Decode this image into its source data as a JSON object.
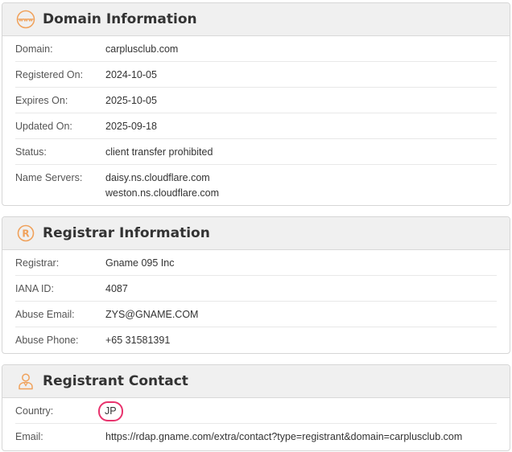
{
  "domain_info": {
    "title": "Domain Information",
    "rows": [
      {
        "label": "Domain:",
        "value": "carplusclub.com"
      },
      {
        "label": "Registered On:",
        "value": "2024-10-05"
      },
      {
        "label": "Expires On:",
        "value": "2025-10-05"
      },
      {
        "label": "Updated On:",
        "value": "2025-09-18"
      },
      {
        "label": "Status:",
        "value": "client transfer prohibited"
      }
    ],
    "name_servers_label": "Name Servers:",
    "name_servers": [
      "daisy.ns.cloudflare.com",
      "weston.ns.cloudflare.com"
    ]
  },
  "registrar_info": {
    "title": "Registrar Information",
    "rows": [
      {
        "label": "Registrar:",
        "value": "Gname 095 Inc"
      },
      {
        "label": "IANA ID:",
        "value": "4087"
      },
      {
        "label": "Abuse Email:",
        "value": "ZYS@GNAME.COM"
      },
      {
        "label": "Abuse Phone:",
        "value": "+65 31581391"
      }
    ]
  },
  "registrant_contact": {
    "title": "Registrant Contact",
    "rows": [
      {
        "label": "Country:",
        "value": "JP"
      },
      {
        "label": "Email:",
        "value": "https://rdap.gname.com/extra/contact?type=registrant&domain=carplusclub.com"
      }
    ]
  },
  "colors": {
    "icon_accent": "#f0a15a",
    "highlight_ring": "#e8336d"
  }
}
